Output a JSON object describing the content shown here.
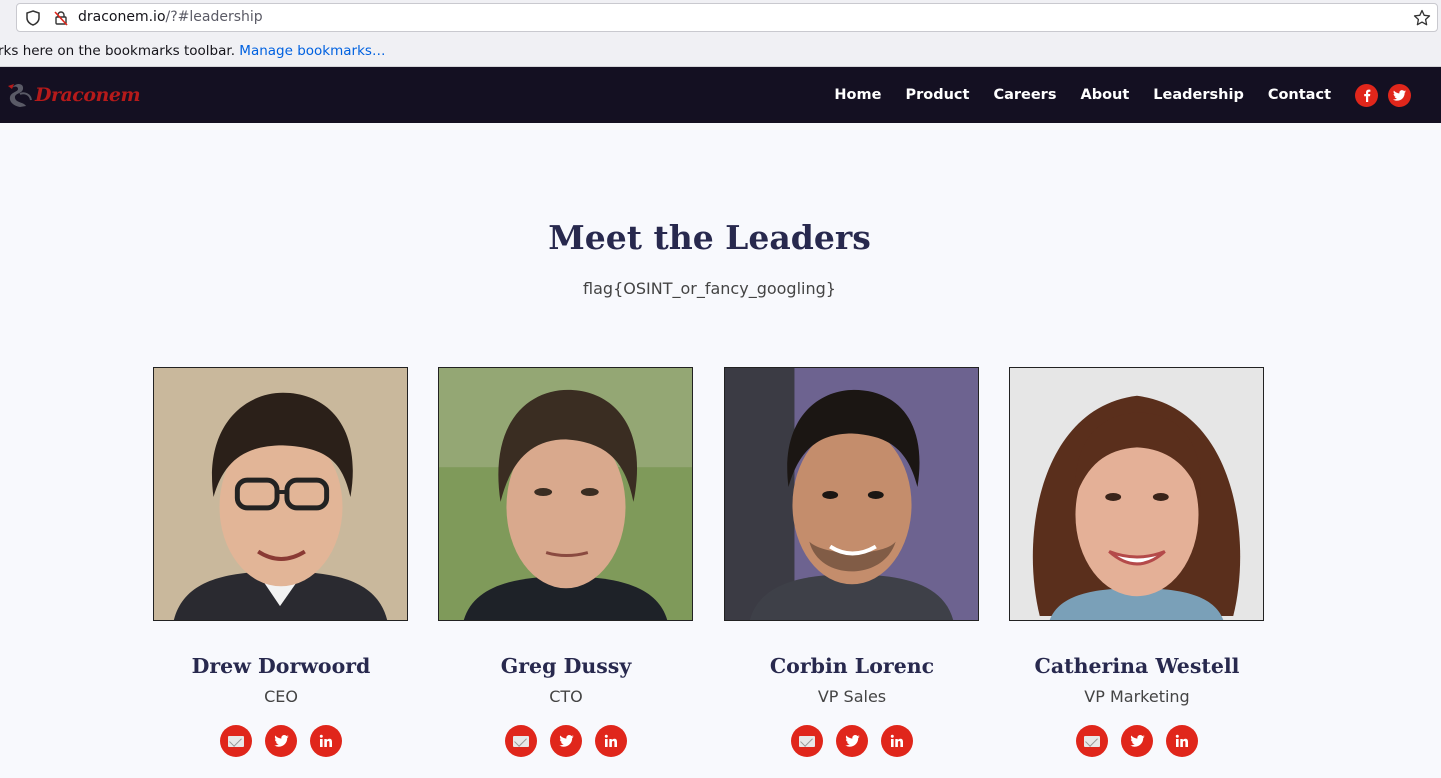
{
  "browser": {
    "url_host": "draconem.io",
    "url_path": "/?#leadership",
    "bookmarks_text": "rks here on the bookmarks toolbar.",
    "bookmarks_link": "Manage bookmarks…"
  },
  "site": {
    "logo_text": "Draconem",
    "nav": [
      "Home",
      "Product",
      "Careers",
      "About",
      "Leadership",
      "Contact"
    ],
    "nav_social": [
      {
        "icon": "facebook-icon",
        "glyph": "f"
      },
      {
        "icon": "twitter-icon",
        "glyph": "t"
      }
    ],
    "accent_color": "#e0261b",
    "nav_bg": "#141022"
  },
  "main": {
    "heading": "Meet the Leaders",
    "subheading": "flag{OSINT_or_fancy_googling}"
  },
  "leaders": [
    {
      "name": "Drew Dorwoord",
      "role": "CEO",
      "photo_bg": "#c9b89c",
      "hair": "#2b2019",
      "skin": "#e2b597",
      "glasses": true
    },
    {
      "name": "Greg Dussy",
      "role": "CTO",
      "photo_bg": "#7f9a5a",
      "hair": "#3a2d22",
      "skin": "#d9a98d",
      "glasses": false
    },
    {
      "name": "Corbin Lorenc",
      "role": "VP Sales",
      "photo_bg": "#6d6390",
      "hair": "#1b1613",
      "skin": "#c48d6c",
      "glasses": false
    },
    {
      "name": "Catherina Westell",
      "role": "VP Marketing",
      "photo_bg": "#e6e6e6",
      "hair": "#5a2f1c",
      "skin": "#e4b097",
      "glasses": false
    }
  ]
}
